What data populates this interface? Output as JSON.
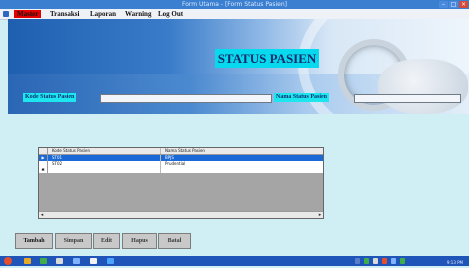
{
  "window": {
    "title": "Form Utama - [Form Status Pasien]"
  },
  "menu": {
    "items": [
      "Master",
      "Transaksi",
      "Laporan",
      "Warning",
      "Log Out"
    ],
    "active_index": 0
  },
  "banner": {
    "title": "STATUS PASIEN"
  },
  "form": {
    "kode_label": "Kode Status Pasien",
    "kode_value": "",
    "nama_label": "Nama Status Pasien",
    "nama_value": ""
  },
  "grid": {
    "columns": [
      "Kode Status Pasien",
      "Nama Status Pasien"
    ],
    "rows": [
      {
        "indicator": "▶",
        "kode": "ST01",
        "nama": "BPJS",
        "selected": true
      },
      {
        "indicator": "",
        "kode": "ST02",
        "nama": "Prudential",
        "selected": false
      }
    ],
    "new_row_indicator": "✱"
  },
  "buttons": {
    "tambah": "Tambah",
    "simpan": "Simpan",
    "edit": "Edit",
    "hapus": "Hapus",
    "batal": "Batal"
  },
  "taskbar": {
    "clock": "9:13 PM"
  },
  "colors": {
    "title_bg": "#07d9ef",
    "label_bg": "#1ee6ee",
    "menu_active": "#e30000",
    "selection": "#1b69d6"
  }
}
